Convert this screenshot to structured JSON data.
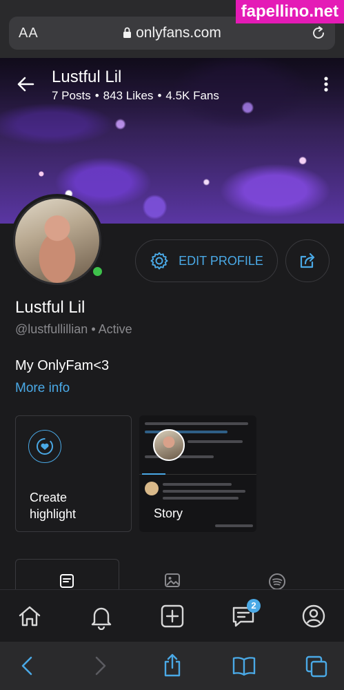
{
  "browser": {
    "aa_label": "AA",
    "url": "onlyfans.com"
  },
  "watermark": "fapellino.net",
  "cover": {
    "name": "Lustful Lil",
    "posts": "7 Posts",
    "likes": "843 Likes",
    "fans": "4.5K Fans",
    "separator": "•"
  },
  "profile": {
    "edit_label": "EDIT PROFILE",
    "display_name": "Lustful Lil",
    "handle": "@lustfullillian",
    "status_sep": "•",
    "status": "Active",
    "bio": "My OnlyFam<3",
    "more_info": "More info"
  },
  "highlights": {
    "create_label_line1": "Create",
    "create_label_line2": "highlight",
    "story_label": "Story"
  },
  "nav": {
    "messages_badge": "2"
  },
  "colors": {
    "accent": "#4aa9e6",
    "online": "#3ec14b",
    "background": "#1b1b1d"
  }
}
